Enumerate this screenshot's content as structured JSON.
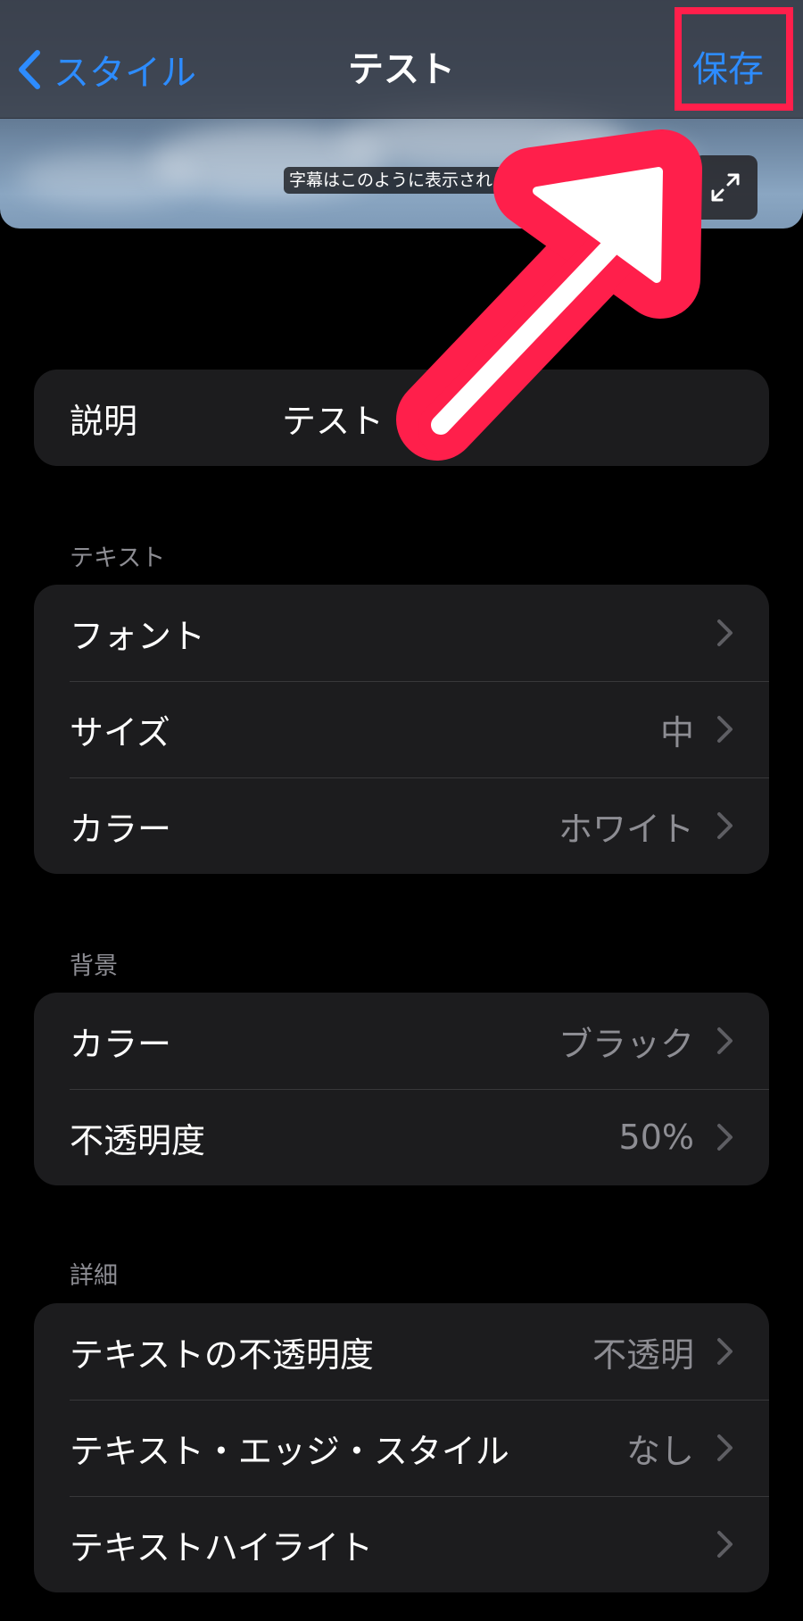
{
  "nav": {
    "back_label": "スタイル",
    "title": "テスト",
    "save_label": "保存"
  },
  "preview": {
    "caption": "字幕はこのように表示されます"
  },
  "description": {
    "label": "説明",
    "value": "テスト"
  },
  "sections": {
    "text": {
      "header": "テキスト",
      "rows": [
        {
          "label": "フォント",
          "value": ""
        },
        {
          "label": "サイズ",
          "value": "中"
        },
        {
          "label": "カラー",
          "value": "ホワイト"
        }
      ]
    },
    "background": {
      "header": "背景",
      "rows": [
        {
          "label": "カラー",
          "value": "ブラック"
        },
        {
          "label": "不透明度",
          "value": "50%"
        }
      ]
    },
    "details": {
      "header": "詳細",
      "rows": [
        {
          "label": "テキストの不透明度",
          "value": "不透明"
        },
        {
          "label": "テキスト・エッジ・スタイル",
          "value": "なし"
        },
        {
          "label": "テキストハイライト",
          "value": ""
        }
      ]
    }
  },
  "colors": {
    "accent": "#2d8cff",
    "annotation": "#ff1f4b",
    "cell_background": "#1c1c1e",
    "secondary_text": "#8d8d93"
  },
  "icons": {
    "back": "chevron-left-icon",
    "expand": "expand-arrows-icon",
    "disclosure": "chevron-right-icon"
  }
}
